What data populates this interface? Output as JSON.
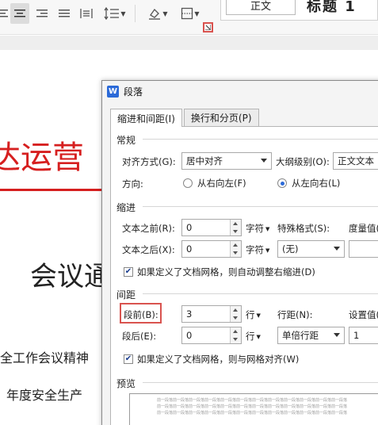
{
  "toolbar": {
    "style_normal_label": "正文",
    "style_heading_label": "标题 1"
  },
  "document": {
    "title": "达运营",
    "subtitle": "会议通",
    "line1": "全工作会议精神",
    "line2": "年度安全生产"
  },
  "dialog": {
    "app_icon": "W",
    "title": "段落",
    "tabs": [
      {
        "label": "缩进和间距(I)",
        "active": true
      },
      {
        "label": "换行和分页(P)",
        "active": false
      }
    ],
    "general": {
      "label": "常规",
      "alignment_label": "对齐方式(G):",
      "alignment_value": "居中对齐",
      "outline_label": "大纲级别(O):",
      "outline_value": "正文文本",
      "direction_label": "方向:",
      "rtl_label": "从右向左(F)",
      "ltr_label": "从左向右(L)",
      "direction_selected": "ltr"
    },
    "indent": {
      "label": "缩进",
      "before_label": "文本之前(R):",
      "before_value": "0",
      "before_unit": "字符",
      "after_label": "文本之后(X):",
      "after_value": "0",
      "after_unit": "字符",
      "special_label": "特殊格式(S):",
      "special_value": "(无)",
      "measure_label": "度量值(Y):",
      "auto_adjust_label": "如果定义了文档网格，则自动调整右缩进(D)",
      "auto_adjust_checked": true
    },
    "spacing": {
      "label": "间距",
      "before_label": "段前(B):",
      "before_value": "3",
      "before_unit": "行",
      "after_label": "段后(E):",
      "after_value": "0",
      "after_unit": "行",
      "line_spacing_label": "行距(N):",
      "line_spacing_value": "单倍行距",
      "setting_label": "设置值(A):",
      "setting_value": "1",
      "snap_grid_label": "如果定义了文档网格，则与网格对齐(W)",
      "snap_grid_checked": true
    },
    "preview": {
      "label": "预览",
      "sample_text": "前一段落前一段落前一段落前一段落前一段落前一段落前一段落前一段落前一段落前一段落前一段落前一段落"
    }
  },
  "colors": {
    "accent": "#2b6ad8",
    "highlight": "#d9534f",
    "title_red": "#d61f1f"
  }
}
